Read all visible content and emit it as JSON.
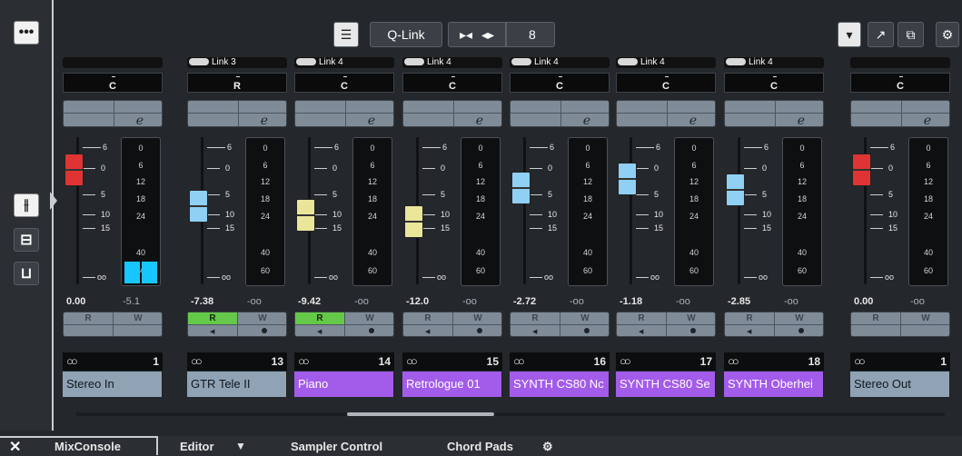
{
  "toolbar": {
    "qlink_label": "Q-Link",
    "link_count": "8"
  },
  "channels": [
    {
      "link": "",
      "pan": "C",
      "volume": "0.00",
      "peak": "-5.1",
      "type": "stereo-in",
      "number": "1",
      "name": "Stereo In",
      "color": "#8fa3b5",
      "cap_color": "#e03434",
      "read_on": false,
      "channel_index": "0"
    },
    {
      "link": "Link 3",
      "pan": "R",
      "volume": "-7.38",
      "peak": "-oo",
      "number": "13",
      "name": "GTR Tele II",
      "color": "#8fa3b5",
      "cap_color": "#8fd0f4",
      "read_on": true
    },
    {
      "link": "Link 4",
      "pan": "C",
      "volume": "-9.42",
      "peak": "-oo",
      "number": "14",
      "name": "Piano",
      "color": "#a35bea",
      "cap_color": "#e9e69a",
      "read_on": true
    },
    {
      "link": "Link 4",
      "pan": "C",
      "volume": "-12.0",
      "peak": "-oo",
      "number": "15",
      "name": "Retrologue 01",
      "color": "#a35bea",
      "cap_color": "#e9e69a",
      "read_on": false
    },
    {
      "link": "Link 4",
      "pan": "C",
      "volume": "-2.72",
      "peak": "-oo",
      "number": "16",
      "name": "SYNTH CS80 Nc",
      "color": "#a35bea",
      "cap_color": "#8fd0f4",
      "read_on": false
    },
    {
      "link": "Link 4",
      "pan": "C",
      "volume": "-1.18",
      "peak": "-oo",
      "number": "17",
      "name": "SYNTH CS80 Se",
      "color": "#a35bea",
      "cap_color": "#8fd0f4",
      "read_on": false
    },
    {
      "link": "Link 4",
      "pan": "C",
      "volume": "-2.85",
      "peak": "-oo",
      "number": "18",
      "name": "SYNTH Oberhei",
      "color": "#a35bea",
      "cap_color": "#8fd0f4",
      "read_on": false
    },
    {
      "link": "",
      "pan": "C",
      "volume": "0.00",
      "peak": "-oo",
      "number": "1",
      "name": "Stereo Out",
      "color": "#8fa3b5",
      "cap_color": "#e03434",
      "read_on": false
    }
  ],
  "fader_scale": [
    "6",
    "0",
    "5",
    "10",
    "15",
    "oo"
  ],
  "meter_scale": [
    "0",
    "6",
    "12",
    "18",
    "24",
    "40",
    "60"
  ],
  "meter_fill_fraction": 0.15,
  "rw": {
    "read": "R",
    "write": "W"
  },
  "insert_glyph": "e",
  "tabs": {
    "mixconsole": "MixConsole",
    "editor": "Editor",
    "sampler": "Sampler Control",
    "chordpads": "Chord Pads"
  },
  "icons": {
    "menu": "more-icon",
    "faders": "faders-icon",
    "routing": "routing-icon",
    "meter": "meter-icon"
  }
}
